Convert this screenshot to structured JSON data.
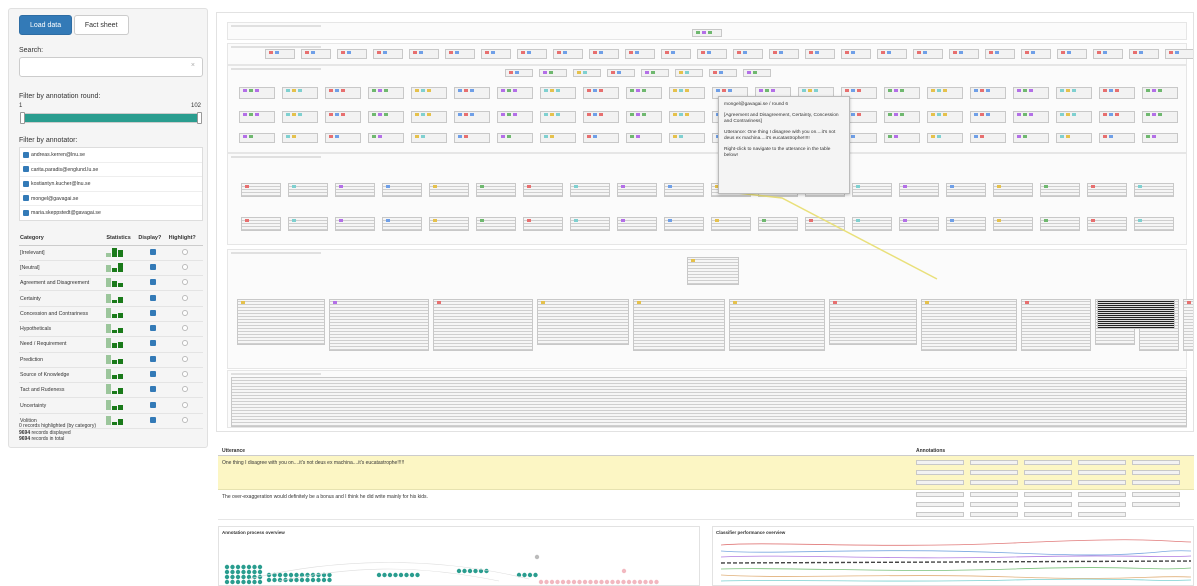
{
  "toolbar": {
    "load_label": "Load data",
    "fact_label": "Fact sheet"
  },
  "search": {
    "label": "Search:",
    "placeholder": "",
    "clear": "×"
  },
  "filter_round": {
    "label": "Filter by annotation round:",
    "min": "1",
    "max": "102",
    "fill_fraction": 1.0
  },
  "filter_annotator": {
    "label": "Filter by annotator:",
    "items": [
      "andreas.kerren@lnu.se",
      "carita.paradis@englund.lu.se",
      "kostiantyn.kucher@lnu.se",
      "mongel@gavagai.se",
      "maria.skeppstedt@gavagai.se"
    ]
  },
  "category_table": {
    "headers": [
      "Category",
      "Statistics",
      "Display?",
      "Highlight?"
    ],
    "rows": [
      "[Irrelevant]",
      "[Neutral]",
      "Agreement and Disagreement",
      "Certainty",
      "Concession and Contrariness",
      "Hypotheticals",
      "Need / Requirement",
      "Prediction",
      "Source of Knowledge",
      "Tact and Rudeness",
      "Uncertainty",
      "Volition"
    ]
  },
  "summary": {
    "line1": "0 records highlighted (by category)",
    "line2_bold": "9694",
    "line2": " records displayed",
    "line3_bold": "9694",
    "line3": " records in total"
  },
  "tooltip": {
    "header": "mongel@gavagai.se / round 6",
    "categories": "[Agreement and Disagreement, Certainty, Concession and Contrariness]",
    "utterance": "Utterance: One thing I disagree with you on....it's not deus ex machina....it's eucatastrophe!!!!!",
    "hint": "Right-click to navigate to the utterance in the table below!"
  },
  "utterances": {
    "col_utterance": "Utterance",
    "col_annotations": "Annotations",
    "rows": [
      "One thing I disagree with you on....it's not deus ex machina....it's eucatastrophe!!!!!",
      "The over-exaggeration would definitely be a bonus and I think he did write mainly for his kids."
    ]
  },
  "panels": {
    "process_title": "Annotation process overview",
    "classifier_title": "Classifier performance overview"
  },
  "colors": {
    "primary": "#337ab7",
    "teal": "#2a9d8f",
    "highlight_row": "#fcf6c4",
    "stat_bar": "#1a7a1a"
  }
}
